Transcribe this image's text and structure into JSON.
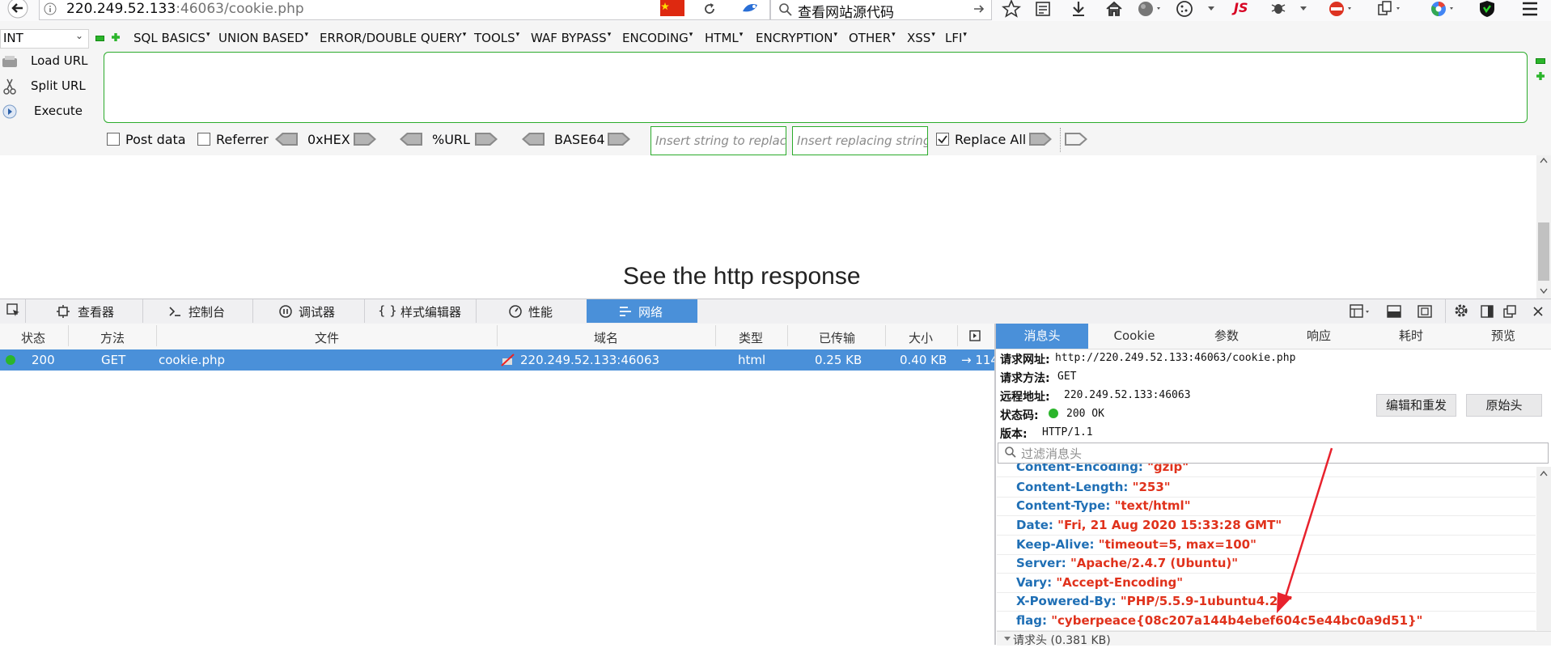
{
  "browser": {
    "url_host": "220.249.52.133",
    "url_rest": ":46063/cookie.php",
    "search_placeholder": "查看网站源代码"
  },
  "hackbar": {
    "int_select": "INT",
    "menus": [
      "SQL BASICS",
      "UNION BASED",
      "ERROR/DOUBLE QUERY",
      "TOOLS",
      "WAF BYPASS",
      "ENCODING",
      "HTML",
      "ENCRYPTION",
      "OTHER",
      "XSS",
      "LFI"
    ],
    "load_url": "Load URL",
    "split_url": "Split URL",
    "execute": "Execute",
    "post_data": "Post data",
    "referrer": "Referrer",
    "hex": "0xHEX",
    "url_enc": "%URL",
    "base64": "BASE64",
    "replace_placeholder": "Insert string to replace",
    "replacing_placeholder": "Insert replacing string",
    "replace_all": "Replace All"
  },
  "page": {
    "heading": "See the http response"
  },
  "devtools": {
    "tabs": [
      "查看器",
      "控制台",
      "调试器",
      "样式编辑器",
      "性能",
      "网络"
    ],
    "columns": [
      "状态",
      "方法",
      "文件",
      "域名",
      "类型",
      "已传输",
      "大小"
    ],
    "request": {
      "status": "200",
      "method": "GET",
      "file": "cookie.php",
      "domain": "220.249.52.133:46063",
      "type": "html",
      "transferred": "0.25 KB",
      "size": "0.40 KB",
      "timing": "→ 114"
    },
    "detail_tabs": [
      "消息头",
      "Cookie",
      "参数",
      "响应",
      "耗时",
      "预览"
    ],
    "summary": {
      "url_label": "请求网址:",
      "url": "http://220.249.52.133:46063/cookie.php",
      "method_label": "请求方法:",
      "method": "GET",
      "remote_label": "远程地址:",
      "remote": "220.249.52.133:46063",
      "status_label": "状态码:",
      "status": "200 OK",
      "version_label": "版本:",
      "version": "HTTP/1.1"
    },
    "edit_resend": "编辑和重发",
    "raw_headers": "原始头",
    "filter_placeholder": "过滤消息头",
    "response_headers": [
      {
        "key": "Content-Encoding",
        "value": "\"gzip\""
      },
      {
        "key": "Content-Length",
        "value": "\"253\""
      },
      {
        "key": "Content-Type",
        "value": "\"text/html\""
      },
      {
        "key": "Date",
        "value": "\"Fri, 21 Aug 2020 15:33:28 GMT\""
      },
      {
        "key": "Keep-Alive",
        "value": "\"timeout=5, max=100\""
      },
      {
        "key": "Server",
        "value": "\"Apache/2.4.7 (Ubuntu)\""
      },
      {
        "key": "Vary",
        "value": "\"Accept-Encoding\""
      },
      {
        "key": "X-Powered-By",
        "value": "\"PHP/5.5.9-1ubuntu4.26\""
      },
      {
        "key": "flag",
        "value": "\"cyberpeace{08c207a144b4ebef604c5e44bc0a9d51}\""
      }
    ],
    "request_headers_section": "请求头 (0.381 KB)"
  },
  "colors": {
    "accent": "#4a90d9",
    "header_key": "#1f6fb5",
    "header_value": "#e0321c",
    "status_green": "#2bb52b",
    "annotation_arrow": "#e8222d"
  }
}
